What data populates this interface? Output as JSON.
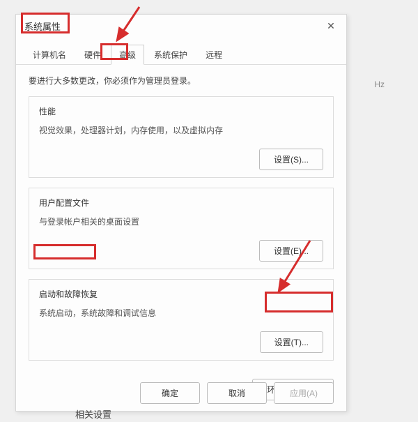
{
  "bg_text": "Hz",
  "related_settings": "相关设置",
  "dialog": {
    "title": "系统属性",
    "tabs": {
      "computer_name": "计算机名",
      "hardware": "硬件",
      "advanced": "高级",
      "system_protection": "系统保护",
      "remote": "远程"
    },
    "req_text": "要进行大多数更改，你必须作为管理员登录。",
    "perf": {
      "title": "性能",
      "desc": "视觉效果，处理器计划，内存使用，以及虚拟内存",
      "btn": "设置(S)..."
    },
    "profile": {
      "title": "用户配置文件",
      "desc": "与登录帐户相关的桌面设置",
      "btn": "设置(E)..."
    },
    "startup": {
      "title": "启动和故障恢复",
      "desc": "系统启动，系统故障和调试信息",
      "btn": "设置(T)..."
    },
    "env_btn": "环境变量(N)...",
    "footer": {
      "ok": "确定",
      "cancel": "取消",
      "apply": "应用(A)"
    }
  }
}
